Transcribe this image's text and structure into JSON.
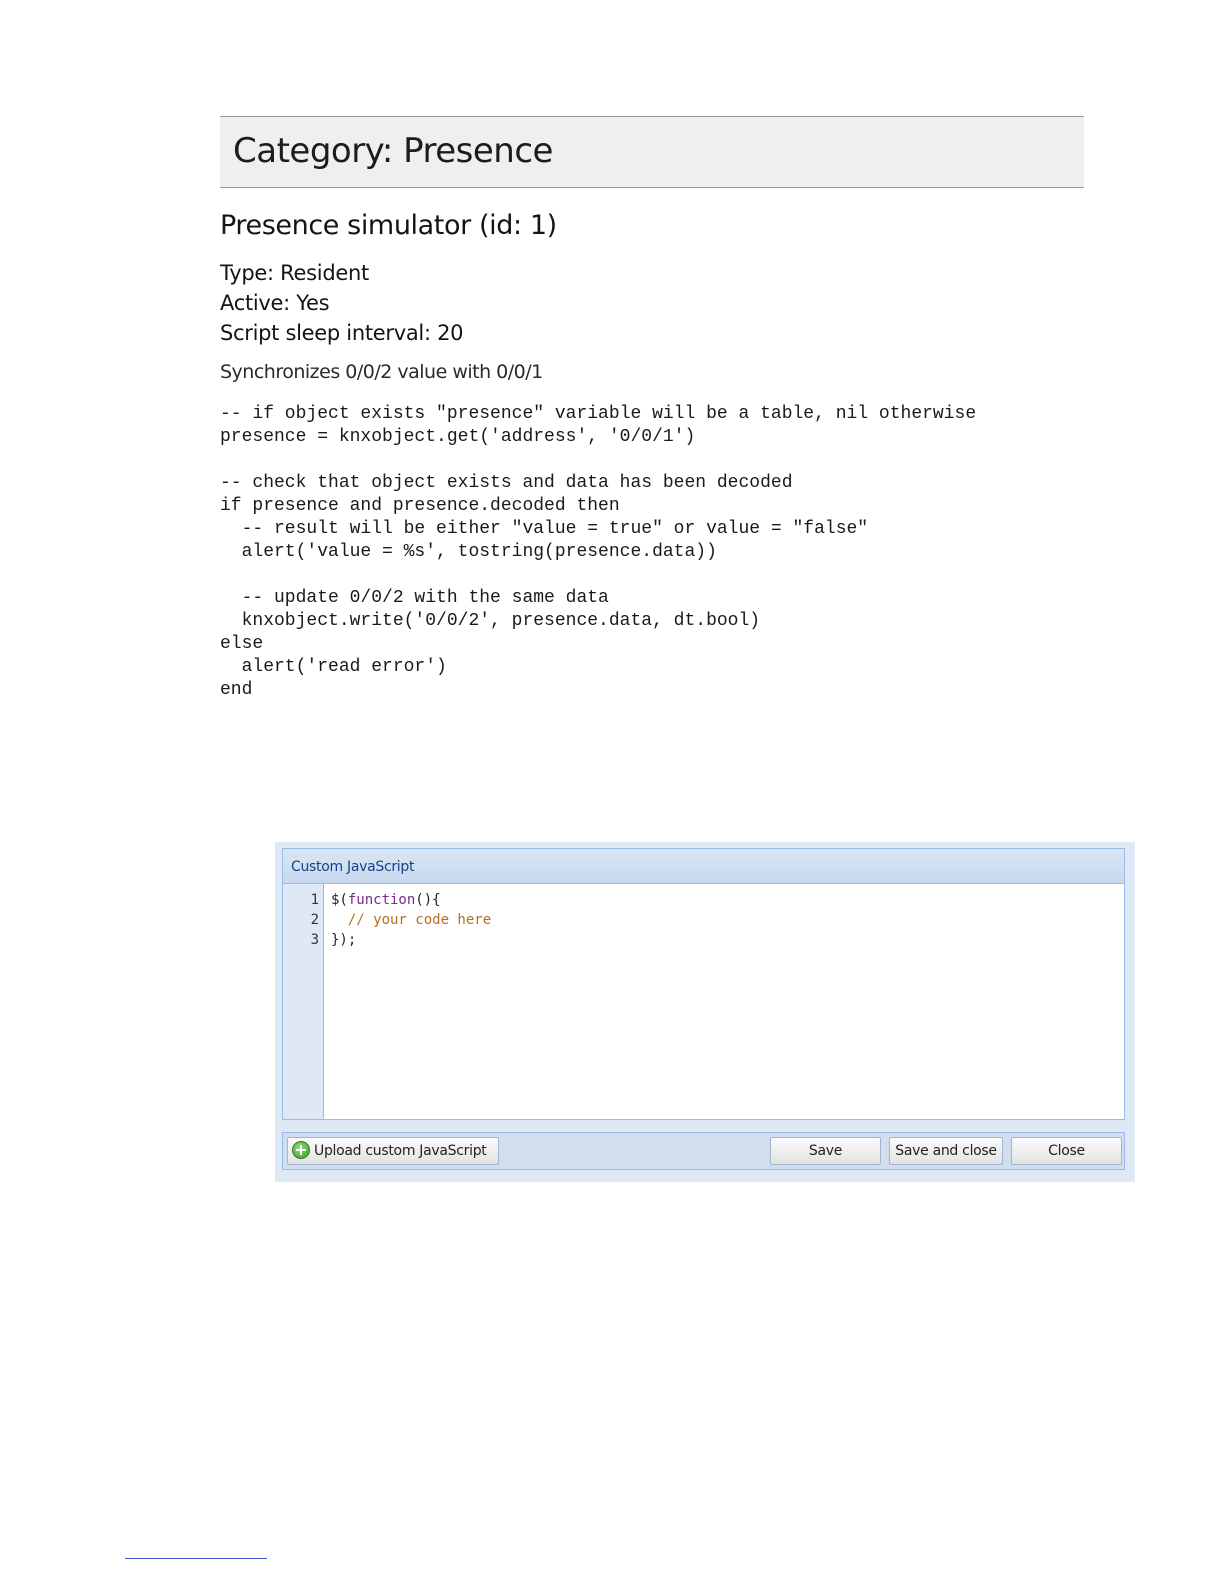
{
  "document": {
    "category_title": "Category: Presence",
    "script_title": "Presence simulator (id: 1)",
    "meta": [
      "Type: Resident",
      "Active: Yes",
      "Script sleep interval: 20"
    ],
    "description": "Synchronizes 0/0/2 value with 0/0/1",
    "code_lines": [
      "-- if object exists \"presence\" variable will be a table, nil otherwise",
      "presence = knxobject.get('address', '0/0/1')",
      "",
      "-- check that object exists and data has been decoded",
      "if presence and presence.decoded then",
      "  -- result will be either \"value = true\" or value = \"false\"",
      "  alert('value = %s', tostring(presence.data))",
      "",
      "  -- update 0/0/2 with the same data",
      "  knxobject.write('0/0/2', presence.data, dt.bool)",
      "else",
      "  alert('read error')",
      "end"
    ]
  },
  "dialog": {
    "title": "Custom JavaScript",
    "line_numbers": [
      "1",
      "2",
      "3"
    ],
    "editor": {
      "line1_prefix": "$(",
      "line1_keyword": "function",
      "line1_suffix": "(){",
      "line2_comment": "  // your code here",
      "line3": "});"
    },
    "buttons": {
      "upload_label": "Upload custom JavaScript",
      "upload_icon": "add-circle-icon",
      "save_label": "Save",
      "save_close_label": "Save and close",
      "close_label": "Close"
    }
  },
  "colors": {
    "panel_border": "#99bbe8",
    "panel_title": "#15428b",
    "keyword": "#7b2a8c",
    "comment": "#b86f1d"
  }
}
